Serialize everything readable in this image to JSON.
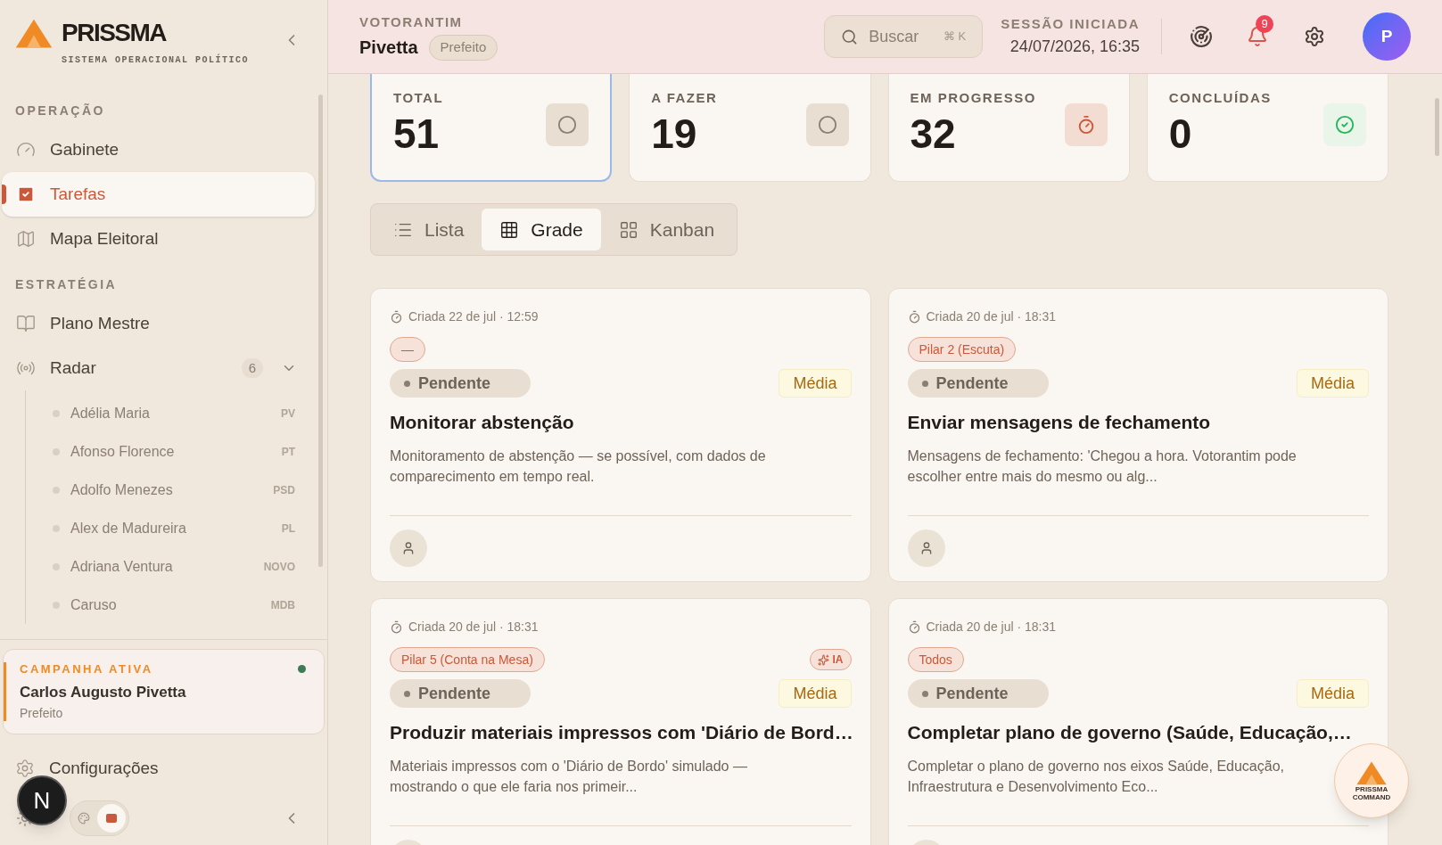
{
  "sidebar": {
    "logo": {
      "name": "PRISSMA",
      "tagline": "SISTEMA OPERACIONAL POLÍTICO"
    },
    "sections": [
      {
        "heading": "OPERAÇÃO",
        "items": [
          {
            "label": "Gabinete",
            "kind": "gauge",
            "selected": false
          },
          {
            "label": "Tarefas",
            "kind": "tasks",
            "selected": true
          },
          {
            "label": "Mapa Eleitoral",
            "kind": "map",
            "selected": false
          }
        ]
      },
      {
        "heading": "ESTRATÉGIA",
        "items": [
          {
            "label": "Plano Mestre",
            "kind": "book",
            "selected": false
          },
          {
            "label": "Radar",
            "kind": "radar",
            "selected": false,
            "badge": "6",
            "expanded": true,
            "children": [
              {
                "label": "Adélia Maria",
                "party": "PV"
              },
              {
                "label": "Afonso Florence",
                "party": "PT"
              },
              {
                "label": "Adolfo Menezes",
                "party": "PSD"
              },
              {
                "label": "Alex de Madureira",
                "party": "PL"
              },
              {
                "label": "Adriana Ventura",
                "party": "NOVO"
              },
              {
                "label": "Caruso",
                "party": "MDB"
              }
            ]
          }
        ]
      }
    ],
    "campaign": {
      "heading": "CAMPANHA ATIVA",
      "name": "Carlos Augusto Pivetta",
      "role": "Prefeito",
      "active": true
    },
    "settings": "Configurações",
    "dev_badge": "N",
    "theme_custom": true
  },
  "header": {
    "org": "VOTORANTIM",
    "name": "Pivetta",
    "role": "Prefeito",
    "search": {
      "placeholder": "Buscar",
      "shortcut": "⌘ K"
    },
    "session_label": "SESSÃO INICIADA",
    "session_time": "24/07/2026, 16:35",
    "notifications": "9",
    "avatar": "P"
  },
  "stats": [
    {
      "label": "TOTAL",
      "value": "51",
      "kind": "todo",
      "selected": true
    },
    {
      "label": "A FAZER",
      "value": "19",
      "kind": "todo",
      "selected": false
    },
    {
      "label": "EM PROGRESSO",
      "value": "32",
      "kind": "progress",
      "selected": false
    },
    {
      "label": "CONCLUÍDAS",
      "value": "0",
      "kind": "done",
      "selected": false
    }
  ],
  "views": [
    {
      "label": "Lista",
      "kind": "list",
      "selected": false
    },
    {
      "label": "Grade",
      "kind": "grid",
      "selected": true
    },
    {
      "label": "Kanban",
      "kind": "kanban",
      "selected": false
    }
  ],
  "tasks": [
    {
      "created": "Criada 22 de jul · 12:59",
      "tag": "—",
      "status": "Pendente",
      "priority": "Média",
      "title": "Monitorar abstenção",
      "description": "Monitoramento de abstenção — se possível, com dados de comparecimento em tempo real."
    },
    {
      "created": "Criada 20 de jul · 18:31",
      "tag": "Pilar 2 (Escuta)",
      "status": "Pendente",
      "priority": "Média",
      "title": "Enviar mensagens de fechamento",
      "description": "Mensagens de fechamento: 'Chegou a hora. Votorantim pode escolher entre mais do mesmo ou alg..."
    },
    {
      "created": "Criada 20 de jul · 18:31",
      "tag": "Pilar 5 (Conta na Mesa)",
      "ai_label": "IA",
      "status": "Pendente",
      "priority": "Média",
      "title": "Produzir materiais impressos com 'Diário de Bord…",
      "description": "Materiais impressos com o 'Diário de Bordo' simulado — mostrando o que ele faria nos primeir..."
    },
    {
      "created": "Criada 20 de jul · 18:31",
      "tag": "Todos",
      "status": "Pendente",
      "priority": "Média",
      "title": "Completar plano de governo (Saúde, Educação,…",
      "description": "Completar o plano de governo nos eixos Saúde, Educação, Infraestrutura e Desenvolvimento Eco..."
    }
  ],
  "command": {
    "line1": "PRISSMA",
    "line2": "COMMAND"
  }
}
